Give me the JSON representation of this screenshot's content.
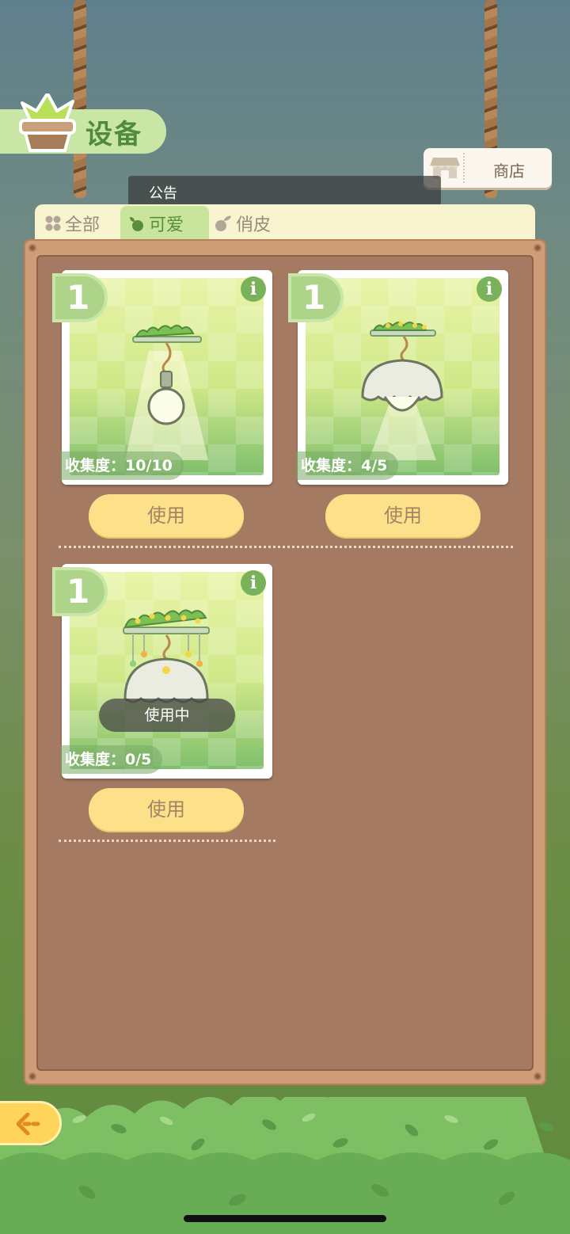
{
  "header": {
    "title": "设备",
    "shop_label": "商店"
  },
  "notice": {
    "label": "公告"
  },
  "tabs": [
    {
      "label": "全部",
      "icon": "grid-icon",
      "active": false
    },
    {
      "label": "可爱",
      "icon": "sprout-icon",
      "active": true
    },
    {
      "label": "俏皮",
      "icon": "leaf-icon",
      "active": false
    }
  ],
  "items": [
    {
      "count": "1",
      "collection": "收集度：10/10",
      "button": "使用",
      "status": "",
      "art": "vine-bulb-lamp"
    },
    {
      "count": "1",
      "collection": "收集度：4/5",
      "button": "使用",
      "status": "",
      "art": "flower-dome-lamp"
    },
    {
      "count": "1",
      "collection": "收集度：0/5",
      "button": "使用",
      "status": "使用中",
      "art": "star-garland-dome-lamp"
    }
  ],
  "colors": {
    "accent_green": "#79b25a",
    "button_yellow": "#fde08a",
    "board_brown": "#a47a62"
  }
}
